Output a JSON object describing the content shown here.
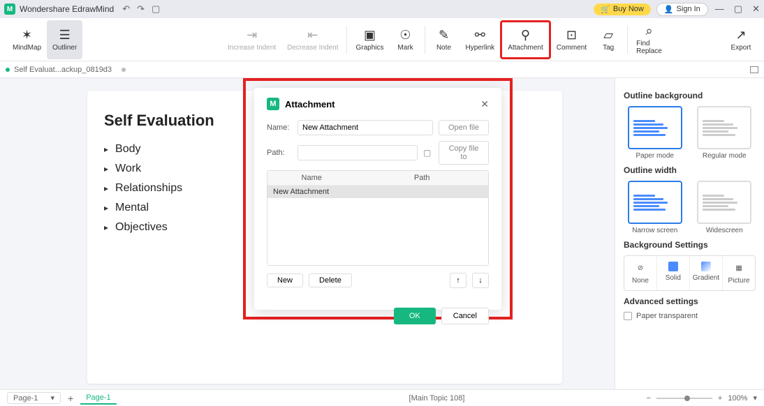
{
  "titlebar": {
    "app_name": "Wondershare EdrawMind",
    "buy": "Buy Now",
    "signin": "Sign In"
  },
  "toolbar": {
    "mindmap": "MindMap",
    "outliner": "Outliner",
    "inc_indent": "Increase Indent",
    "dec_indent": "Decrease Indent",
    "graphics": "Graphics",
    "mark": "Mark",
    "note": "Note",
    "hyperlink": "Hyperlink",
    "attachment": "Attachment",
    "comment": "Comment",
    "tag": "Tag",
    "find_replace": "Find Replace",
    "export": "Export"
  },
  "tab": {
    "filename": "Self Evaluat...ackup_0819d3"
  },
  "document": {
    "title": "Self Evaluation",
    "items": [
      "Body",
      "Work",
      "Relationships",
      "Mental",
      "Objectives"
    ]
  },
  "side": {
    "bg_title": "Outline background",
    "paper": "Paper mode",
    "regular": "Regular mode",
    "width_title": "Outline width",
    "narrow": "Narrow screen",
    "wide": "Widescreen",
    "bgset_title": "Background Settings",
    "none": "None",
    "solid": "Solid",
    "gradient": "Gradient",
    "picture": "Picture",
    "adv_title": "Advanced settings",
    "paper_trans": "Paper transparent"
  },
  "modal": {
    "title": "Attachment",
    "name_label": "Name:",
    "name_value": "New Attachment",
    "path_label": "Path:",
    "open_file": "Open file",
    "copy_file": "Copy file to",
    "col_name": "Name",
    "col_path": "Path",
    "row1": "New Attachment",
    "new": "New",
    "delete": "Delete",
    "ok": "OK",
    "cancel": "Cancel"
  },
  "status": {
    "page_sel": "Page-1",
    "page_tab": "Page-1",
    "topic": "[Main Topic 108]",
    "zoom": "100%"
  }
}
